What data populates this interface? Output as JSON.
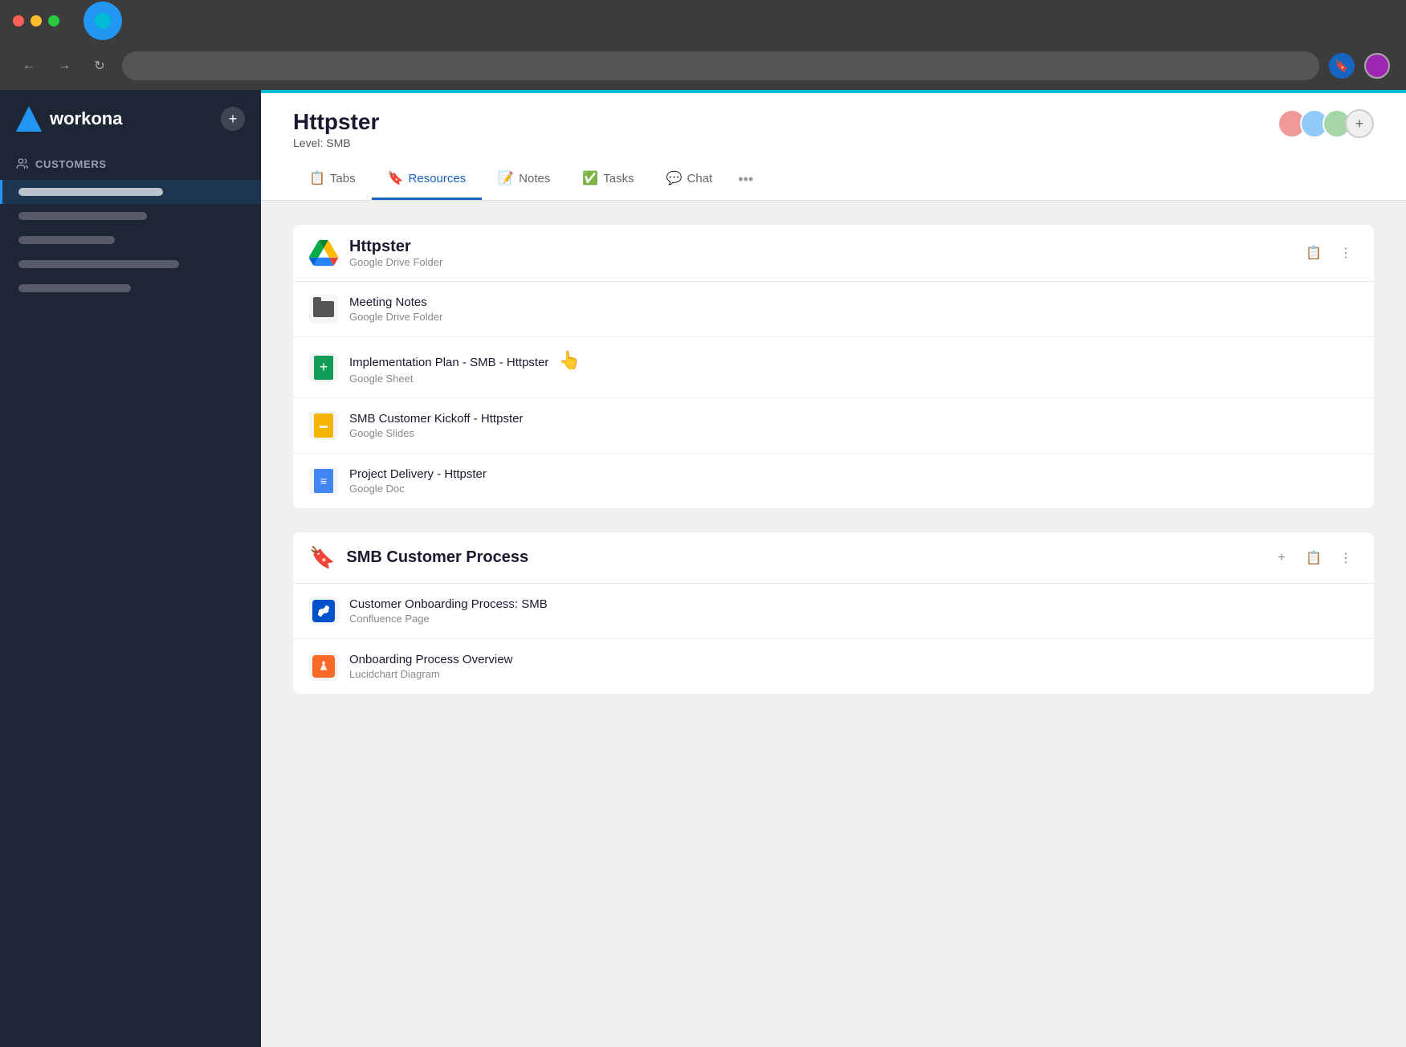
{
  "browser": {
    "back_label": "←",
    "forward_label": "→",
    "reload_label": "↻",
    "address_value": ""
  },
  "sidebar": {
    "logo_text": "workona",
    "plus_label": "+",
    "section_label": "CUSTOMERS",
    "items": [
      {
        "label": "",
        "active": true
      },
      {
        "label": "",
        "active": false,
        "width": "w1"
      },
      {
        "label": "",
        "active": false,
        "width": "w2"
      },
      {
        "label": "",
        "active": false,
        "width": "w3"
      },
      {
        "label": "",
        "active": false,
        "width": "w4"
      }
    ]
  },
  "header": {
    "title": "Httpster",
    "subtitle_label": "Level:",
    "subtitle_value": "SMB",
    "tabs": [
      {
        "id": "tabs",
        "label": "Tabs",
        "icon": "📋",
        "active": false
      },
      {
        "id": "resources",
        "label": "Resources",
        "icon": "🔖",
        "active": true
      },
      {
        "id": "notes",
        "label": "Notes",
        "icon": "📝",
        "active": false
      },
      {
        "id": "tasks",
        "label": "Tasks",
        "icon": "✅",
        "active": false
      },
      {
        "id": "chat",
        "label": "Chat",
        "icon": "💬",
        "active": false
      }
    ],
    "more_label": "•••"
  },
  "resource_groups": [
    {
      "id": "httpster-group",
      "title": "Httpster",
      "subtitle": "Google Drive Folder",
      "icon_type": "gdrive",
      "actions": [
        "copy",
        "more"
      ],
      "items": [
        {
          "name": "Meeting Notes",
          "type": "Google Drive Folder",
          "icon": "folder-dark"
        },
        {
          "name": "Implementation Plan - SMB - Httpster",
          "type": "Google Sheet",
          "icon": "gsheet",
          "has_cursor": true
        },
        {
          "name": "SMB Customer Kickoff - Httpster",
          "type": "Google Slides",
          "icon": "gslides"
        },
        {
          "name": "Project Delivery - Httpster",
          "type": "Google Doc",
          "icon": "gdoc"
        }
      ]
    },
    {
      "id": "smb-process-group",
      "title": "SMB Customer Process",
      "subtitle": "",
      "icon_type": "bookmark",
      "actions": [
        "add",
        "copy",
        "more"
      ],
      "items": [
        {
          "name": "Customer Onboarding Process: SMB",
          "type": "Confluence Page",
          "icon": "confluence"
        },
        {
          "name": "Onboarding Process Overview",
          "type": "Lucidchart Diagram",
          "icon": "lucidchart"
        }
      ]
    }
  ],
  "icons": {
    "copy_icon": "📋",
    "more_icon": "⋮",
    "add_icon": "+"
  }
}
